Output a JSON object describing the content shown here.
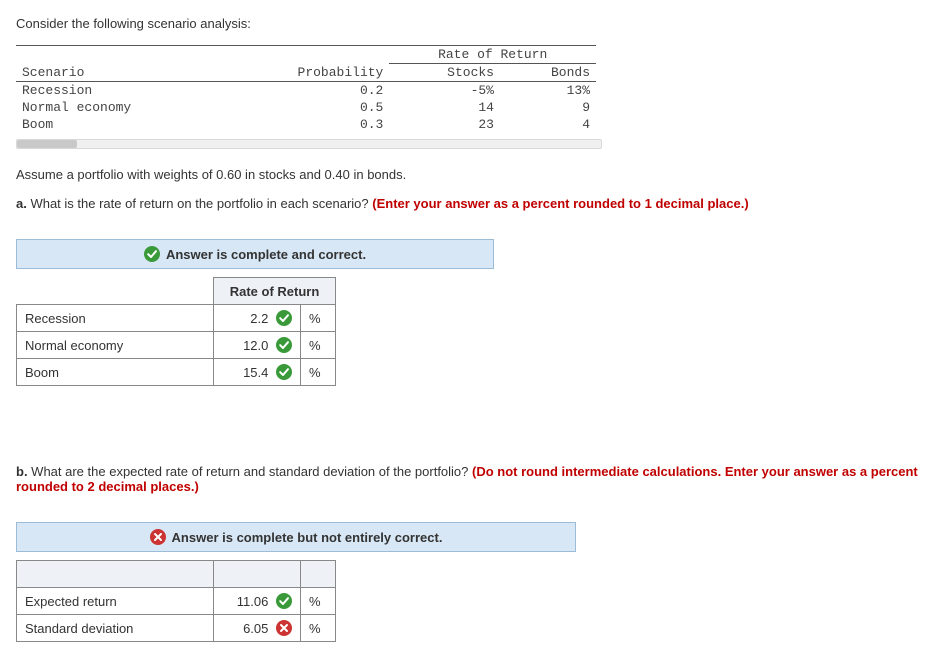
{
  "intro": "Consider the following scenario analysis:",
  "scenario_table": {
    "header_group": "Rate of Return",
    "cols": {
      "c0": "Scenario",
      "c1": "Probability",
      "c2": "Stocks",
      "c3": "Bonds"
    },
    "rows": [
      {
        "scenario": "Recession",
        "prob": "0.2",
        "stocks": "-5%",
        "bonds": "13%"
      },
      {
        "scenario": "Normal economy",
        "prob": "0.5",
        "stocks": "14",
        "bonds": "9"
      },
      {
        "scenario": "Boom",
        "prob": "0.3",
        "stocks": "23",
        "bonds": "4"
      }
    ]
  },
  "assumption": "Assume a portfolio with weights of 0.60 in stocks and 0.40 in bonds.",
  "part_a": {
    "label": "a.",
    "question": " What is the rate of return on the portfolio in each scenario? ",
    "note": "(Enter your answer as a percent rounded to 1 decimal place.)",
    "banner": "Answer is complete and correct.",
    "table": {
      "header": "Rate of Return",
      "rows": [
        {
          "label": "Recession",
          "value": "2.2",
          "pct": "%"
        },
        {
          "label": "Normal economy",
          "value": "12.0",
          "pct": "%"
        },
        {
          "label": "Boom",
          "value": "15.4",
          "pct": "%"
        }
      ]
    }
  },
  "part_b": {
    "label": "b.",
    "question": " What are the expected rate of return and standard deviation of the portfolio? ",
    "note": "(Do not round intermediate calculations. Enter your answer as a percent rounded to 2 decimal places.)",
    "banner": "Answer is complete but not entirely correct.",
    "table": {
      "rows": [
        {
          "label": "Expected return",
          "value": "11.06",
          "pct": "%",
          "ok": true
        },
        {
          "label": "Standard deviation",
          "value": "6.05",
          "pct": "%",
          "ok": false
        }
      ]
    }
  },
  "chart_data": {
    "type": "table",
    "title": "Scenario analysis — portfolio 60% stocks / 40% bonds",
    "scenarios": [
      {
        "name": "Recession",
        "probability": 0.2,
        "stocks_pct": -5,
        "bonds_pct": 13,
        "portfolio_pct": 2.2
      },
      {
        "name": "Normal economy",
        "probability": 0.5,
        "stocks_pct": 14,
        "bonds_pct": 9,
        "portfolio_pct": 12.0
      },
      {
        "name": "Boom",
        "probability": 0.3,
        "stocks_pct": 23,
        "bonds_pct": 4,
        "portfolio_pct": 15.4
      }
    ],
    "portfolio_expected_return_pct": 11.06,
    "portfolio_std_dev_submitted_pct": 6.05,
    "portfolio_std_dev_submitted_correct": false
  }
}
